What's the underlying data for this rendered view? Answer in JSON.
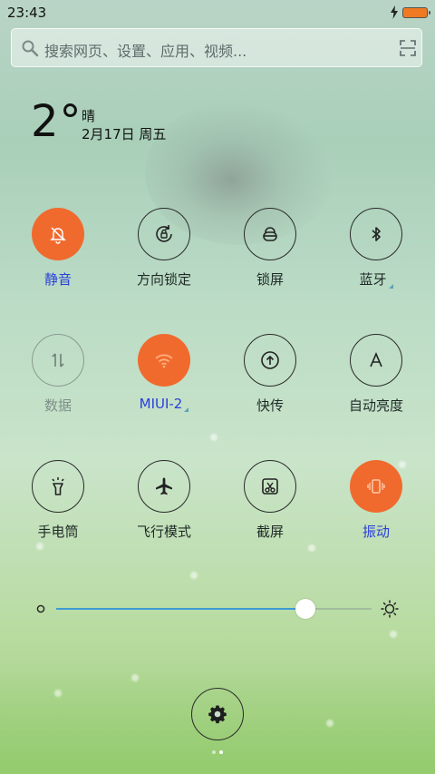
{
  "status_bar": {
    "time": "23:43",
    "charging_icon": "bolt-icon",
    "battery_icon": "battery-icon",
    "battery_color": "#f07a22"
  },
  "search": {
    "placeholder": "搜索网页、设置、应用、视频...",
    "icon": "search-icon",
    "scan_icon": "scan-icon"
  },
  "weather": {
    "temperature": "2°",
    "condition": "晴",
    "date": "2月17日 周五"
  },
  "toggles": [
    {
      "label": "静音",
      "icon": "bell-mute-icon",
      "state": "active"
    },
    {
      "label": "方向锁定",
      "icon": "rotation-lock-icon",
      "state": "normal"
    },
    {
      "label": "锁屏",
      "icon": "lock-icon",
      "state": "normal"
    },
    {
      "label": "蓝牙",
      "icon": "bluetooth-icon",
      "state": "normal",
      "has_more": true
    },
    {
      "label": "数据",
      "icon": "data-icon",
      "state": "disabled"
    },
    {
      "label": "MIUI-2",
      "icon": "wifi-icon",
      "state": "active",
      "has_more": true
    },
    {
      "label": "快传",
      "icon": "quick-share-icon",
      "state": "normal"
    },
    {
      "label": "自动亮度",
      "icon": "auto-brightness-icon",
      "state": "normal"
    },
    {
      "label": "手电筒",
      "icon": "flashlight-icon",
      "state": "normal"
    },
    {
      "label": "飞行模式",
      "icon": "airplane-icon",
      "state": "normal"
    },
    {
      "label": "截屏",
      "icon": "screenshot-icon",
      "state": "normal"
    },
    {
      "label": "振动",
      "icon": "vibrate-icon",
      "state": "active"
    }
  ],
  "brightness": {
    "level": 0.79,
    "min_icon": "dim-icon",
    "max_icon": "sun-icon"
  },
  "settings_button": {
    "icon": "gear-icon"
  },
  "page_indicator": {
    "pages": 2,
    "current": 2
  },
  "colors": {
    "accent_active": "#f06a2e",
    "label_active": "#2a3fd8",
    "slider_fill": "#3e9ad3"
  }
}
